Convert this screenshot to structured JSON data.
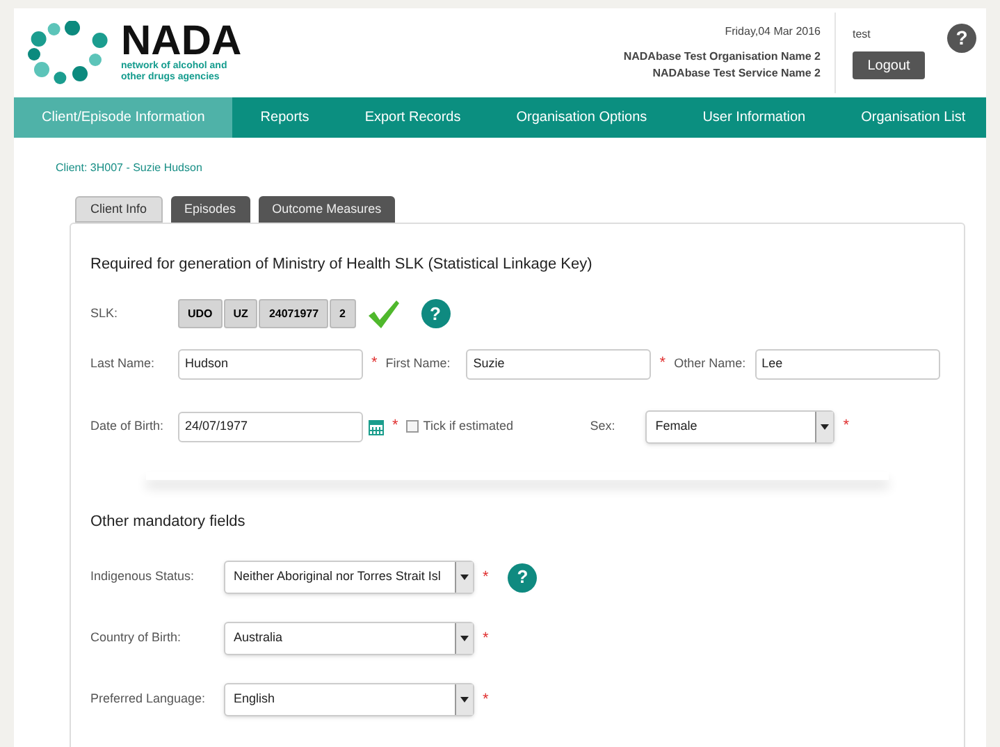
{
  "logo": {
    "name": "NADA",
    "tagline_1": "network of alcohol and",
    "tagline_2": "other drugs agencies"
  },
  "header": {
    "date": "Friday,04 Mar 2016",
    "organisation": "NADAbase Test Organisation Name 2",
    "service": "NADAbase Test Service Name 2",
    "user": "test",
    "logout": "Logout",
    "help": "?"
  },
  "nav": [
    {
      "label": "Client/Episode Information",
      "selected": true
    },
    {
      "label": "Reports",
      "selected": false
    },
    {
      "label": "Export Records",
      "selected": false
    },
    {
      "label": "Organisation Options",
      "selected": false
    },
    {
      "label": "User Information",
      "selected": false
    },
    {
      "label": "Organisation List",
      "selected": false
    }
  ],
  "client": "Client: 3H007 - Suzie Hudson",
  "tabs": [
    {
      "label": "Client Info",
      "selected": true
    },
    {
      "label": "Episodes",
      "selected": false
    },
    {
      "label": "Outcome Measures",
      "selected": false
    }
  ],
  "slk_section": {
    "heading": "Required for generation of Ministry of Health SLK (Statistical Linkage Key)",
    "slk_label": "SLK:",
    "slk_parts": [
      "UDO",
      "UZ",
      "24071977",
      "2"
    ],
    "valid": true,
    "help": "?",
    "names": [
      {
        "label": "Last Name:",
        "value": "Hudson"
      },
      {
        "label": "First Name:",
        "value": "Suzie"
      },
      {
        "label": "Other Name:",
        "value": "Lee"
      }
    ],
    "required_mark": "*",
    "dob": {
      "label": "Date of Birth:",
      "value": "24/07/1977",
      "estimated_label": "Tick if estimated",
      "estimated": false
    },
    "sex": {
      "label": "Sex:",
      "value": "Female"
    }
  },
  "other_section": {
    "heading": "Other mandatory fields",
    "fields": [
      {
        "label": "Indigenous Status:",
        "value": "Neither Aboriginal nor Torres Strait Isl",
        "help": "?"
      },
      {
        "label": "Country of Birth:",
        "value": "Australia"
      },
      {
        "label": "Preferred Language:",
        "value": "English"
      }
    ]
  }
}
